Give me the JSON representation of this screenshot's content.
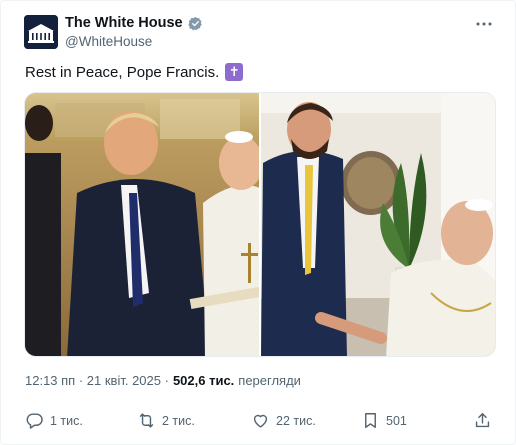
{
  "account": {
    "display_name": "The White House",
    "handle": "@WhiteHouse",
    "verified_badge_color": "#829aab"
  },
  "post": {
    "text": "Rest in Peace, Pope Francis.",
    "emoji": "✝",
    "emoji_bg": "#8e6ccf"
  },
  "meta": {
    "timestamp": "12:13 пп · 21 квіт. 2025 ·",
    "views_count": "502,6 тис.",
    "views_label": "перегляди"
  },
  "actions": {
    "replies": "1 тис.",
    "reposts": "2 тис.",
    "likes": "22 тис.",
    "bookmarks": "501"
  },
  "icons": {
    "more": "more-dots-icon",
    "reply": "reply-icon",
    "repost": "repost-icon",
    "like": "heart-icon",
    "bookmark": "bookmark-icon",
    "share": "share-icon"
  }
}
